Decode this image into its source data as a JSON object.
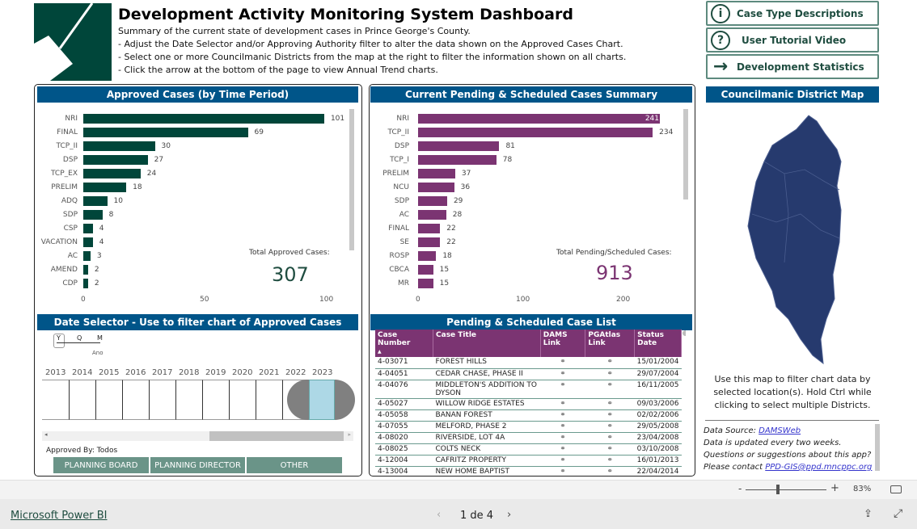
{
  "header": {
    "title": "Development Activity Monitoring System Dashboard",
    "lines": [
      "Summary of the current state of development cases in Prince George's County.",
      "- Adjust the Date Selector and/or Approving Authority filter to alter the data shown on the Approved Cases Chart.",
      "- Select one or more Councilmanic Districts from the map at the right to filter the information shown on all charts.",
      "- Click the arrow at the bottom of the page to view Annual Trend charts."
    ]
  },
  "nav_buttons": [
    {
      "label": "Case Type Descriptions",
      "icon": "info-icon"
    },
    {
      "label": "User Tutorial Video",
      "icon": "question-icon"
    },
    {
      "label": "Development Statistics",
      "icon": "arrow-right-icon"
    }
  ],
  "approved": {
    "title": "Approved Cases (by Time Period)",
    "total_label": "Total Approved Cases:",
    "total": "307"
  },
  "pending": {
    "title": "Current Pending & Scheduled Cases Summary",
    "total_label": "Total Pending/Scheduled Cases:",
    "total": "913"
  },
  "chart_data": [
    {
      "type": "bar",
      "orientation": "horizontal",
      "title": "Approved Cases (by Time Period)",
      "categories": [
        "NRI",
        "FINAL",
        "TCP_II",
        "DSP",
        "TCP_EX",
        "PRELIM",
        "ADQ",
        "SDP",
        "CSP",
        "VACATION",
        "AC",
        "AMEND",
        "CDP"
      ],
      "values": [
        101,
        69,
        30,
        27,
        24,
        18,
        10,
        8,
        4,
        4,
        3,
        2,
        2
      ],
      "xticks": [
        "0",
        "50",
        "100"
      ],
      "xlim": [
        0,
        110
      ],
      "color": "#00463a"
    },
    {
      "type": "bar",
      "orientation": "horizontal",
      "title": "Current Pending & Scheduled Cases Summary",
      "categories": [
        "NRI",
        "TCP_II",
        "DSP",
        "TCP_I",
        "PRELIM",
        "NCU",
        "SDP",
        "AC",
        "FINAL",
        "SE",
        "ROSP",
        "CBCA",
        "MR"
      ],
      "values": [
        241,
        234,
        81,
        78,
        37,
        36,
        29,
        28,
        22,
        22,
        18,
        15,
        15
      ],
      "xticks": [
        "0",
        "100",
        "200"
      ],
      "xlim": [
        0,
        270
      ],
      "color": "#7b3472"
    }
  ],
  "date_selector": {
    "title": "Date Selector - Use to filter chart of Approved Cases",
    "levels": [
      "Y",
      "Q",
      "M"
    ],
    "level_label": "Ano",
    "years": [
      "2013",
      "2014",
      "2015",
      "2016",
      "2017",
      "2018",
      "2019",
      "2020",
      "2021",
      "2022",
      "2023"
    ],
    "selected_year": "2023",
    "approved_by": "Approved By: Todos",
    "authorities": [
      "PLANNING BOARD",
      "PLANNING DIRECTOR",
      "OTHER"
    ]
  },
  "case_list": {
    "title": "Pending & Scheduled Case List",
    "columns": [
      "Case Number",
      "Case Title",
      "DAMS Link",
      "PGAtlas Link",
      "Status Date"
    ],
    "rows": [
      [
        "4-03071",
        "FOREST HILLS",
        "15/01/2004"
      ],
      [
        "4-04051",
        "CEDAR CHASE, PHASE II",
        "29/07/2004"
      ],
      [
        "4-04076",
        "MIDDLETON'S ADDITION TO DYSON",
        "16/11/2005"
      ],
      [
        "4-05027",
        "WILLOW RIDGE ESTATES",
        "09/03/2006"
      ],
      [
        "4-05058",
        "BANAN FOREST",
        "02/02/2006"
      ],
      [
        "4-07055",
        "MELFORD, PHASE 2",
        "29/05/2008"
      ],
      [
        "4-08020",
        "RIVERSIDE, LOT 4A",
        "23/04/2008"
      ],
      [
        "4-08025",
        "COLTS NECK",
        "03/10/2008"
      ],
      [
        "4-12004",
        "CAFRITZ PROPERTY",
        "16/01/2013"
      ],
      [
        "4-13004",
        "NEW HOME BAPTIST CHURCH",
        "22/04/2014"
      ]
    ]
  },
  "map": {
    "title": "Councilmanic District Map",
    "instructions": "Use this map to filter chart data by selected location(s). Hold Ctrl while clicking to select multiple Districts.",
    "color": "#263a6e"
  },
  "info": {
    "source_label": "Data Source: ",
    "source_link": "DAMSWeb",
    "update": "Data is updated every two weeks.",
    "questions": "Questions or suggestions about this app?",
    "contact_label": "Please contact ",
    "contact_email": "PPD-GIS@ppd.mncppc.org"
  },
  "zoom": {
    "minus": "-",
    "plus": "+",
    "level": "83%",
    "value_percent": 83
  },
  "footer": {
    "brand": "Microsoft Power BI",
    "page": "1 de 4"
  }
}
